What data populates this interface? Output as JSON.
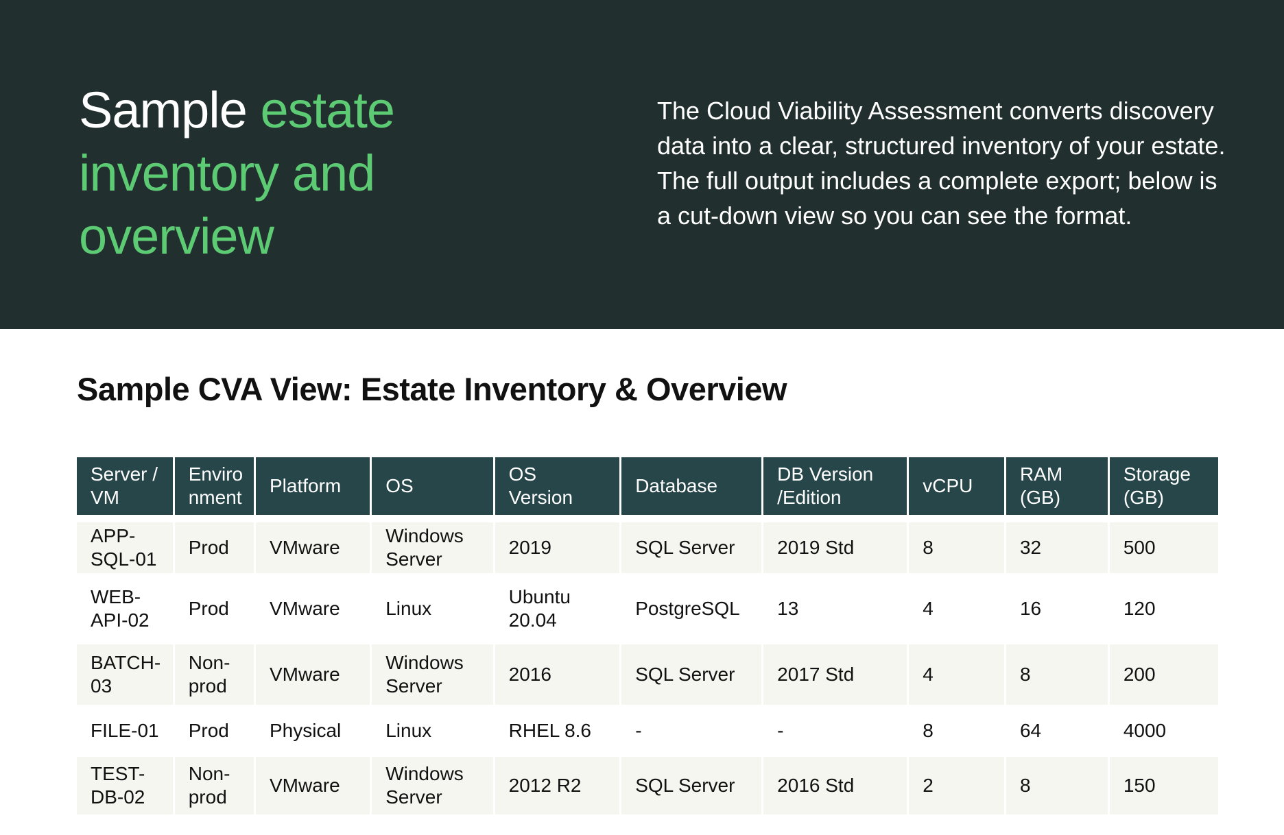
{
  "hero": {
    "title_white": "Sample ",
    "title_green": "estate inventory and overview",
    "description": "The Cloud Viability Assessment converts discovery data into a clear, structured inventory of your estate. The full output includes a complete export; below is a cut-down view so you can see the format."
  },
  "section": {
    "title": "Sample CVA View: Estate Inventory & Overview"
  },
  "table": {
    "headers": [
      "Server / VM",
      "Enviro nment",
      "Platform",
      "OS",
      "OS Version",
      "Database",
      "DB Version /Edition",
      "vCPU",
      "RAM (GB)",
      "Storage (GB)"
    ],
    "rows": [
      [
        "APP-SQL-01",
        "Prod",
        "VMware",
        "Windows Server",
        "2019",
        "SQL Server",
        "2019 Std",
        "8",
        "32",
        "500"
      ],
      [
        "WEB-API-02",
        "Prod",
        "VMware",
        "Linux",
        "Ubuntu 20.04",
        "PostgreSQL",
        "13",
        "4",
        "16",
        "120"
      ],
      [
        "BATCH-03",
        "Non-prod",
        "VMware",
        "Windows Server",
        "2016",
        "SQL Server",
        "2017 Std",
        "4",
        "8",
        "200"
      ],
      [
        "FILE-01",
        "Prod",
        "Physical",
        "Linux",
        "RHEL 8.6",
        "-",
        "-",
        "8",
        "64",
        "4000"
      ],
      [
        "TEST-DB-02",
        "Non-prod",
        "VMware",
        "Windows Server",
        "2012 R2",
        "SQL Server",
        "2016 Std",
        "2",
        "8",
        "150"
      ]
    ]
  },
  "colors": {
    "hero_background": "#222f2f",
    "accent_green": "#5ccb73",
    "table_header": "#27464a",
    "row_shade": "#f6f6f1"
  }
}
